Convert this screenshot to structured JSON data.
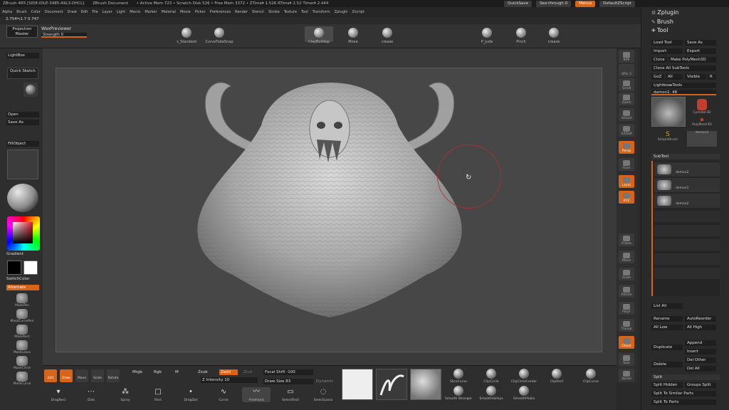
{
  "titlebar": {
    "app": "ZBrush 4R5 [SIDE-IDLE-3485-A9L3-DHCL]",
    "doc": "ZBrush Document",
    "mem": "• Active Mem 723 • Scratch Disk 526 • Free Mem 3372 • ZTime⏵ 1.526 RTime⏵ 2.52 Timer⏵ 2.444"
  },
  "top_buttons": {
    "quicksave": "QuickSave",
    "seethrough": "See-through 0",
    "menus": "Menus",
    "defaultscript": "DefaultZScript"
  },
  "menubar": [
    "Alpha",
    "Brush",
    "Color",
    "Document",
    "Draw",
    "Edit",
    "File",
    "Layer",
    "Light",
    "Macro",
    "Marker",
    "Material",
    "Movie",
    "Picker",
    "Preferences",
    "Render",
    "Stencil",
    "Stroke",
    "Texture",
    "Tool",
    "Transform",
    "Zplugin",
    "Zscript"
  ],
  "coord": "2.754≒1.7 0.747",
  "topshelf": {
    "projection_master": "Projection Master",
    "waxpreviewer": "WaxPreviewer",
    "strength": "Strength 0",
    "tools": [
      {
        "label": "s_Standard"
      },
      {
        "label": "CurveTubeSnap"
      },
      {
        "label": "ClayBuildup"
      },
      {
        "label": "Move"
      },
      {
        "label": "crease"
      },
      {
        "label": "P_Jude"
      },
      {
        "label": "Pinch"
      },
      {
        "label": "crease"
      }
    ]
  },
  "leftshelf": {
    "lightbox": "LightBox",
    "quick_sketch": "Quick Sketch",
    "open": "Open",
    "saveas": "Save As",
    "fillobject": "FillObject",
    "gradient": "Gradient",
    "switchcolor": "SwitchColor",
    "alternate": "Alternate",
    "alphas": [
      "MaskPen",
      "MaskCurvePen",
      "MaskRect",
      "MaskLasso",
      "MaskCircle",
      "MaskCurve"
    ]
  },
  "rightdock": [
    "BPR",
    "SPix 3",
    "Scroll",
    "Zoom",
    "Actual",
    "AAHalf",
    "Persp",
    "Floor",
    "Local",
    "XYZ",
    "Frame",
    "Move",
    "Scale",
    "Rotate",
    "PolyF",
    "Transp",
    "Ghost",
    "Solo",
    "Xpose"
  ],
  "rightpanel": {
    "zplugin": "Zplugin",
    "brush": "Brush",
    "tool": "Tool",
    "load_tool": "Load Tool",
    "save_as": "Save As",
    "import": "Import",
    "export": "Export",
    "clone": "Clone",
    "make_polymesh": "Make PolyMesh3D",
    "clone_all": "Clone All SubTools",
    "goz": "GoZ",
    "all": "All",
    "visible": "Visible",
    "r": "R",
    "lightbox_tools": "Lightbox▸Tools",
    "current_tool": "demon2. 48",
    "thumbs": [
      "Cylinder3D",
      "PolyMesh3D",
      "SimpleBrush",
      "demon2"
    ],
    "subtool_head": "SubTool",
    "subtools": [
      "demon2",
      "demon1",
      "demon2"
    ],
    "list_all": "List All",
    "rename": "Rename",
    "autoreorder": "AutoReorder",
    "all_low": "All Low",
    "all_high": "All High",
    "duplicate": "Duplicate",
    "append": "Append",
    "insert": "Insert",
    "delete": "Delete",
    "del_other": "Del Other",
    "del_all": "Del All",
    "split_head": "Split",
    "split_hidden": "Split Hidden",
    "groups_split": "Groups Split",
    "split_similar": "Split To Similar Parts",
    "split_parts": "Split To Parts"
  },
  "bottomshelf": {
    "modes": [
      "Edit",
      "Draw",
      "Move",
      "Scale",
      "Rotate"
    ],
    "mrgb": "Mrgb",
    "rgb": "Rgb",
    "m": "M",
    "zsub": "Zsub",
    "zadd": "Zadd",
    "zcut": "Zcut",
    "intensity": "Z Intensity 10",
    "focal": "Focal Shift -100",
    "drawsize": "Draw Size 83",
    "dynamic": "Dynamic",
    "strokes": [
      "DragRect",
      "Dots",
      "Spray",
      "Rect",
      "DragDot",
      "Curve",
      "Freehand",
      "SelectRect",
      "SelectLasso"
    ],
    "small_brushes": [
      "SliceCurve",
      "ClipCircle",
      "ClipCircleCenter",
      "ClipRect",
      "ClipCurve",
      "Smooth Stronger",
      "SmoothValleys",
      "SmoothPeaks"
    ]
  }
}
